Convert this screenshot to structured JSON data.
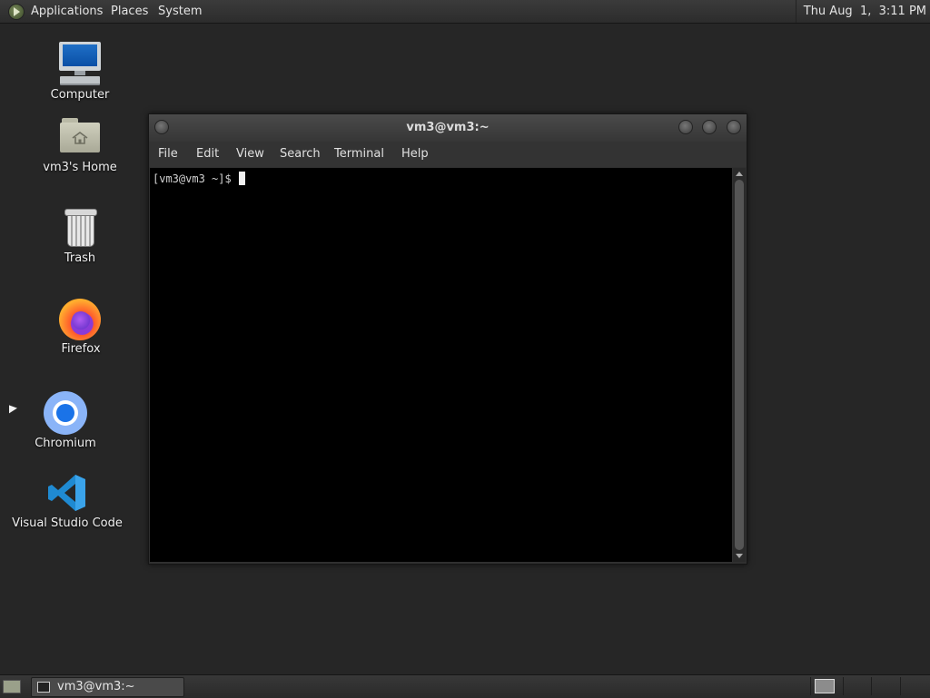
{
  "top_panel": {
    "menus": [
      "Applications",
      "Places",
      "System"
    ],
    "clock": "Thu Aug  1,  3:11 PM"
  },
  "desktop": {
    "icons": [
      {
        "label": "Computer",
        "icon": "computer-icon"
      },
      {
        "label": "vm3's Home",
        "icon": "home-folder-icon"
      },
      {
        "label": "Trash",
        "icon": "trash-icon"
      },
      {
        "label": "Firefox",
        "icon": "firefox-icon"
      },
      {
        "label": "Chromium",
        "icon": "chromium-icon"
      },
      {
        "label": "Visual Studio Code",
        "icon": "vscode-icon"
      }
    ]
  },
  "terminal": {
    "title": "vm3@vm3:~",
    "menu": [
      "File",
      "Edit",
      "View",
      "Search",
      "Terminal",
      "Help"
    ],
    "prompt": "[vm3@vm3 ~]$ "
  },
  "bottom_panel": {
    "task_label": "vm3@vm3:~"
  }
}
